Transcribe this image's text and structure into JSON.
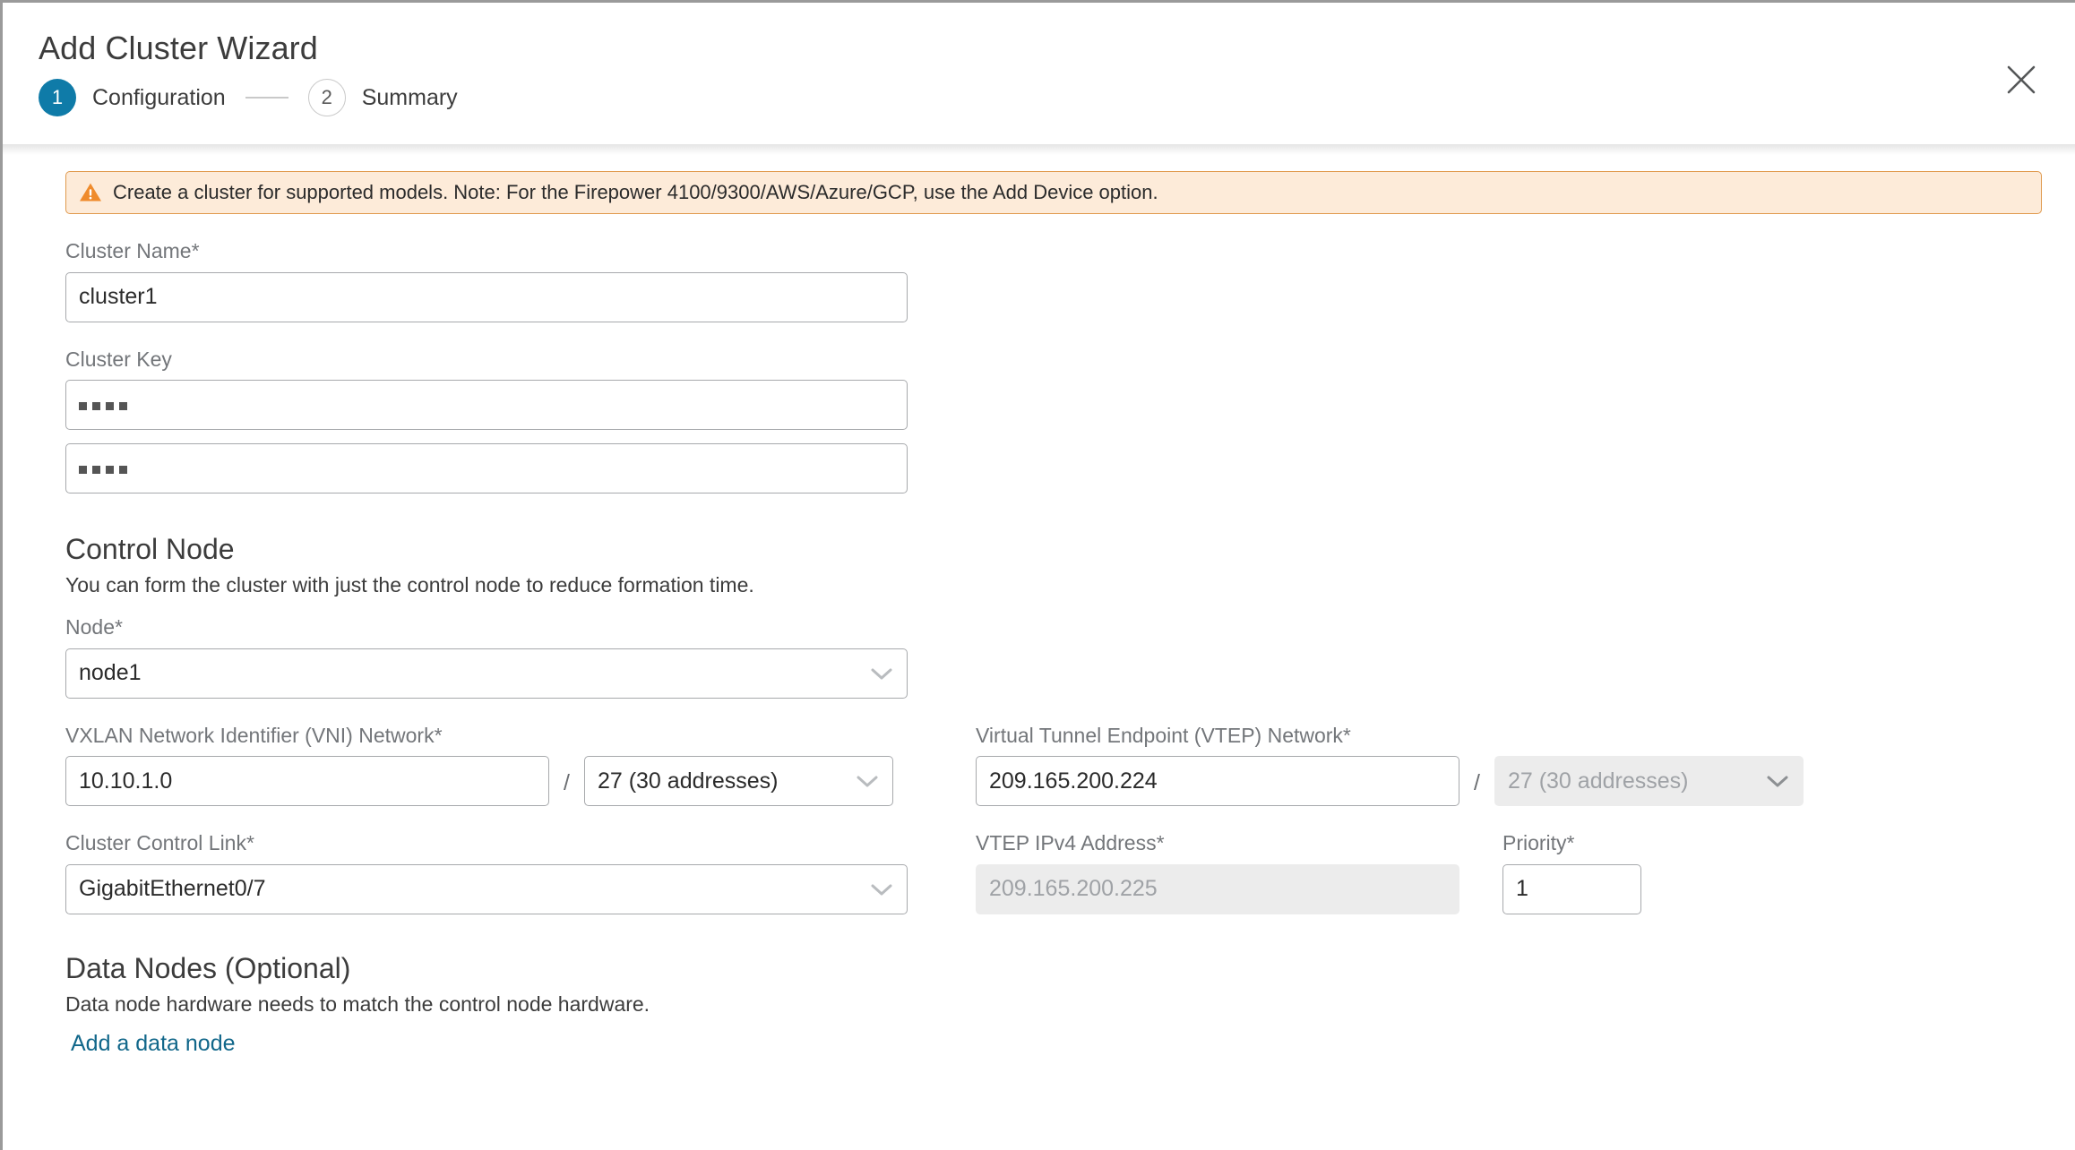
{
  "window": {
    "title": "Add Cluster Wizard",
    "close_icon": "close-icon"
  },
  "steps": [
    {
      "number": "1",
      "label": "Configuration",
      "state": "active"
    },
    {
      "number": "2",
      "label": "Summary",
      "state": "inactive"
    }
  ],
  "banner": {
    "icon": "warning-triangle-icon",
    "text": "Create a cluster for supported models. Note: For the Firepower 4100/9300/AWS/Azure/GCP, use the Add Device option."
  },
  "form": {
    "cluster_name": {
      "label": "Cluster Name*",
      "value": "cluster1",
      "placeholder": ""
    },
    "cluster_key": {
      "label": "Cluster Key",
      "value_1": "••••",
      "value_2": "••••",
      "masked": true
    }
  },
  "control_node": {
    "title": "Control Node",
    "subtitle": "You can form the cluster with just the control node to reduce formation time.",
    "node": {
      "label": "Node*",
      "value": "node1"
    },
    "vni_network": {
      "label": "VXLAN Network Identifier (VNI) Network*",
      "value": "10.10.1.0",
      "separator": "/",
      "mask_value": "27 (30 addresses)",
      "mask_disabled": false
    },
    "vtep_network": {
      "label": "Virtual Tunnel Endpoint (VTEP) Network*",
      "value": "209.165.200.224",
      "separator": "/",
      "mask_value": "27 (30 addresses)",
      "mask_disabled": true
    },
    "cluster_control_link": {
      "label": "Cluster Control Link*",
      "value": "GigabitEthernet0/7"
    },
    "vtep_ipv4": {
      "label": "VTEP IPv4 Address*",
      "value": "209.165.200.225",
      "disabled": true
    },
    "priority": {
      "label": "Priority*",
      "value": "1"
    }
  },
  "data_nodes": {
    "title": "Data Nodes (Optional)",
    "subtitle": "Data node hardware needs to match the control node hardware.",
    "add_link": "Add a data node"
  },
  "colors": {
    "accent": "#0f7ba8",
    "link": "#11678a",
    "warning_border": "#e09a4e",
    "warning_bg": "#fdebd9",
    "warning_icon": "#ef8b2c",
    "field_border": "#a7a9ac",
    "disabled_bg": "#ececec",
    "label_text": "#73767a"
  }
}
